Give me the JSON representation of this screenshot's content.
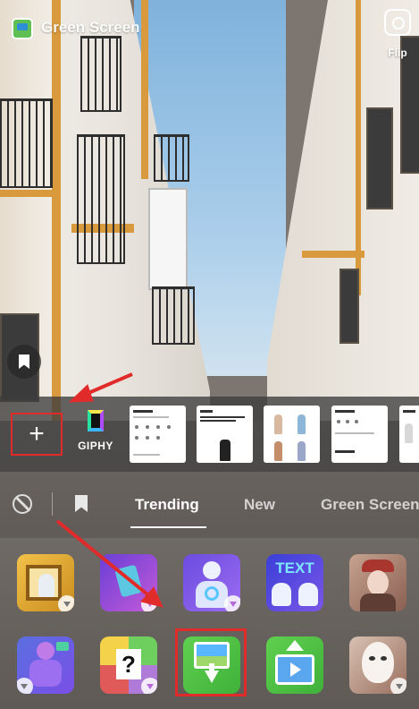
{
  "header": {
    "title": "Green Screen",
    "flip_label": "Flip"
  },
  "media_strip": {
    "add_label": "+",
    "giphy_label": "GIPHY",
    "thumbnails": [
      {
        "header": "Upload Info"
      },
      {
        "header": "Coolful",
        "title": "TECH AND WE SCIENCE WOMEN'S JEANS"
      },
      {
        "header": "New Collection"
      },
      {
        "header": "Select Size",
        "price": "$64.00"
      },
      {
        "header": "Item"
      }
    ]
  },
  "tabs": {
    "items": [
      "Trending",
      "New",
      "Green Screen"
    ],
    "active": "Trending"
  },
  "effects": {
    "row1": [
      "Frame",
      "Paint",
      "Pose",
      "TEXT",
      "Portrait"
    ],
    "row2": [
      "Avatar",
      "Question",
      "Green Screen Image",
      "Video Upload",
      "Mask"
    ],
    "text_effect_label": "TEXT",
    "question_label": "?"
  },
  "colors": {
    "annotation_red": "#e12a2a",
    "download_badge": "#b56bd6"
  }
}
